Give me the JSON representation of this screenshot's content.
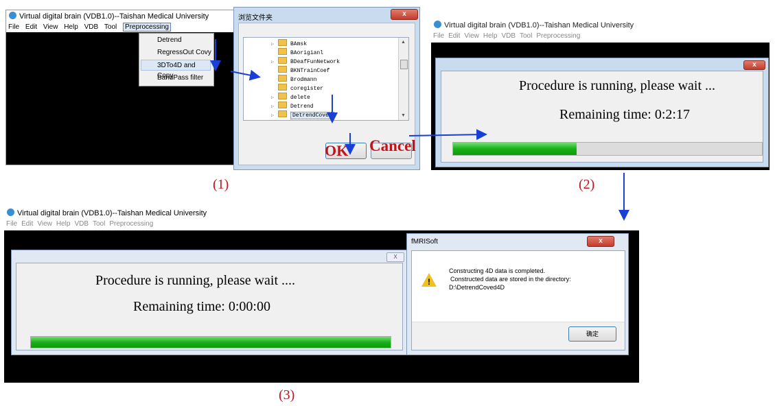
{
  "app_title": "Virtual digital brain (VDB1.0)--Taishan Medical University",
  "menu": [
    "File",
    "Edit",
    "View",
    "Help",
    "VDB",
    "Tool",
    "Preprocessing"
  ],
  "preprocessing_menu": [
    "Detrend",
    "RegressOut Covy",
    "3DTo4D and Copy",
    "BandPass filter"
  ],
  "browse_dialog": {
    "title": "浏览文件夹",
    "folders": [
      "BAmsk",
      "BAorigianl",
      "BDeafFunNetwork",
      "BKNTrainCoef",
      "Brodmann",
      "coregister",
      "delete",
      "Detrend",
      "DetrendCoved"
    ],
    "ok_label": "OK",
    "cancel_label": "Cancel"
  },
  "progress_1": {
    "message": "Procedure is running, please wait ...",
    "remaining": "Remaining time: 0:2:17",
    "progress": 0.4
  },
  "progress_2": {
    "message": "Procedure is running, please wait ....",
    "remaining": "Remaining time: 0:00:00",
    "progress": 1.0
  },
  "msgbox": {
    "title": "fMRISoft",
    "line1": "Constructing 4D data is completed.",
    "line2": "Constructed data are stored in the directory:",
    "line3": "D:\\DetrendCoved4D",
    "ok_label": "确定"
  },
  "captions": [
    "(1)",
    "(2)",
    "(3)"
  ],
  "colors": {
    "arrow": "#1a3fd6",
    "caption": "#c0141c",
    "progress": "#19b019"
  }
}
